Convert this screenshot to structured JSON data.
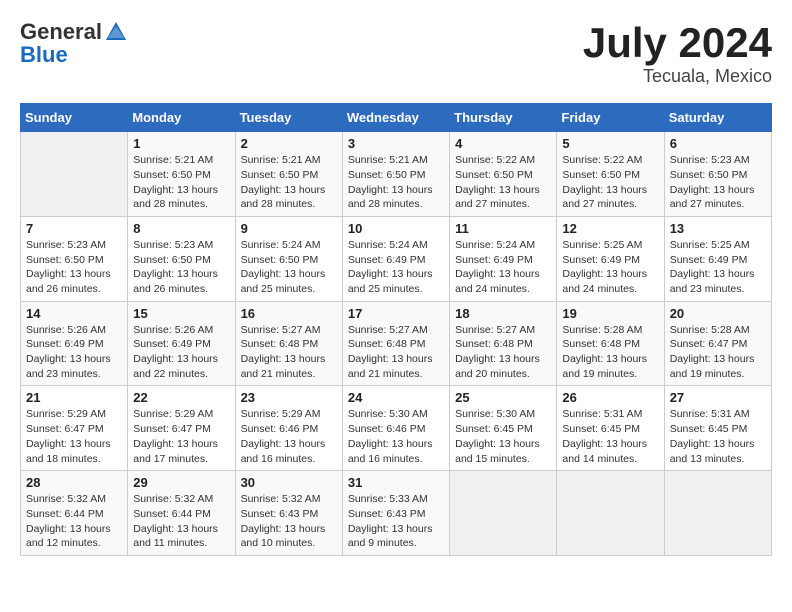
{
  "header": {
    "logo_general": "General",
    "logo_blue": "Blue",
    "title": "July 2024",
    "location": "Tecuala, Mexico"
  },
  "calendar": {
    "days_of_week": [
      "Sunday",
      "Monday",
      "Tuesday",
      "Wednesday",
      "Thursday",
      "Friday",
      "Saturday"
    ],
    "weeks": [
      [
        {
          "day": "",
          "info": ""
        },
        {
          "day": "1",
          "info": "Sunrise: 5:21 AM\nSunset: 6:50 PM\nDaylight: 13 hours\nand 28 minutes."
        },
        {
          "day": "2",
          "info": "Sunrise: 5:21 AM\nSunset: 6:50 PM\nDaylight: 13 hours\nand 28 minutes."
        },
        {
          "day": "3",
          "info": "Sunrise: 5:21 AM\nSunset: 6:50 PM\nDaylight: 13 hours\nand 28 minutes."
        },
        {
          "day": "4",
          "info": "Sunrise: 5:22 AM\nSunset: 6:50 PM\nDaylight: 13 hours\nand 27 minutes."
        },
        {
          "day": "5",
          "info": "Sunrise: 5:22 AM\nSunset: 6:50 PM\nDaylight: 13 hours\nand 27 minutes."
        },
        {
          "day": "6",
          "info": "Sunrise: 5:23 AM\nSunset: 6:50 PM\nDaylight: 13 hours\nand 27 minutes."
        }
      ],
      [
        {
          "day": "7",
          "info": "Sunrise: 5:23 AM\nSunset: 6:50 PM\nDaylight: 13 hours\nand 26 minutes."
        },
        {
          "day": "8",
          "info": "Sunrise: 5:23 AM\nSunset: 6:50 PM\nDaylight: 13 hours\nand 26 minutes."
        },
        {
          "day": "9",
          "info": "Sunrise: 5:24 AM\nSunset: 6:50 PM\nDaylight: 13 hours\nand 25 minutes."
        },
        {
          "day": "10",
          "info": "Sunrise: 5:24 AM\nSunset: 6:49 PM\nDaylight: 13 hours\nand 25 minutes."
        },
        {
          "day": "11",
          "info": "Sunrise: 5:24 AM\nSunset: 6:49 PM\nDaylight: 13 hours\nand 24 minutes."
        },
        {
          "day": "12",
          "info": "Sunrise: 5:25 AM\nSunset: 6:49 PM\nDaylight: 13 hours\nand 24 minutes."
        },
        {
          "day": "13",
          "info": "Sunrise: 5:25 AM\nSunset: 6:49 PM\nDaylight: 13 hours\nand 23 minutes."
        }
      ],
      [
        {
          "day": "14",
          "info": "Sunrise: 5:26 AM\nSunset: 6:49 PM\nDaylight: 13 hours\nand 23 minutes."
        },
        {
          "day": "15",
          "info": "Sunrise: 5:26 AM\nSunset: 6:49 PM\nDaylight: 13 hours\nand 22 minutes."
        },
        {
          "day": "16",
          "info": "Sunrise: 5:27 AM\nSunset: 6:48 PM\nDaylight: 13 hours\nand 21 minutes."
        },
        {
          "day": "17",
          "info": "Sunrise: 5:27 AM\nSunset: 6:48 PM\nDaylight: 13 hours\nand 21 minutes."
        },
        {
          "day": "18",
          "info": "Sunrise: 5:27 AM\nSunset: 6:48 PM\nDaylight: 13 hours\nand 20 minutes."
        },
        {
          "day": "19",
          "info": "Sunrise: 5:28 AM\nSunset: 6:48 PM\nDaylight: 13 hours\nand 19 minutes."
        },
        {
          "day": "20",
          "info": "Sunrise: 5:28 AM\nSunset: 6:47 PM\nDaylight: 13 hours\nand 19 minutes."
        }
      ],
      [
        {
          "day": "21",
          "info": "Sunrise: 5:29 AM\nSunset: 6:47 PM\nDaylight: 13 hours\nand 18 minutes."
        },
        {
          "day": "22",
          "info": "Sunrise: 5:29 AM\nSunset: 6:47 PM\nDaylight: 13 hours\nand 17 minutes."
        },
        {
          "day": "23",
          "info": "Sunrise: 5:29 AM\nSunset: 6:46 PM\nDaylight: 13 hours\nand 16 minutes."
        },
        {
          "day": "24",
          "info": "Sunrise: 5:30 AM\nSunset: 6:46 PM\nDaylight: 13 hours\nand 16 minutes."
        },
        {
          "day": "25",
          "info": "Sunrise: 5:30 AM\nSunset: 6:45 PM\nDaylight: 13 hours\nand 15 minutes."
        },
        {
          "day": "26",
          "info": "Sunrise: 5:31 AM\nSunset: 6:45 PM\nDaylight: 13 hours\nand 14 minutes."
        },
        {
          "day": "27",
          "info": "Sunrise: 5:31 AM\nSunset: 6:45 PM\nDaylight: 13 hours\nand 13 minutes."
        }
      ],
      [
        {
          "day": "28",
          "info": "Sunrise: 5:32 AM\nSunset: 6:44 PM\nDaylight: 13 hours\nand 12 minutes."
        },
        {
          "day": "29",
          "info": "Sunrise: 5:32 AM\nSunset: 6:44 PM\nDaylight: 13 hours\nand 11 minutes."
        },
        {
          "day": "30",
          "info": "Sunrise: 5:32 AM\nSunset: 6:43 PM\nDaylight: 13 hours\nand 10 minutes."
        },
        {
          "day": "31",
          "info": "Sunrise: 5:33 AM\nSunset: 6:43 PM\nDaylight: 13 hours\nand 9 minutes."
        },
        {
          "day": "",
          "info": ""
        },
        {
          "day": "",
          "info": ""
        },
        {
          "day": "",
          "info": ""
        }
      ]
    ]
  }
}
